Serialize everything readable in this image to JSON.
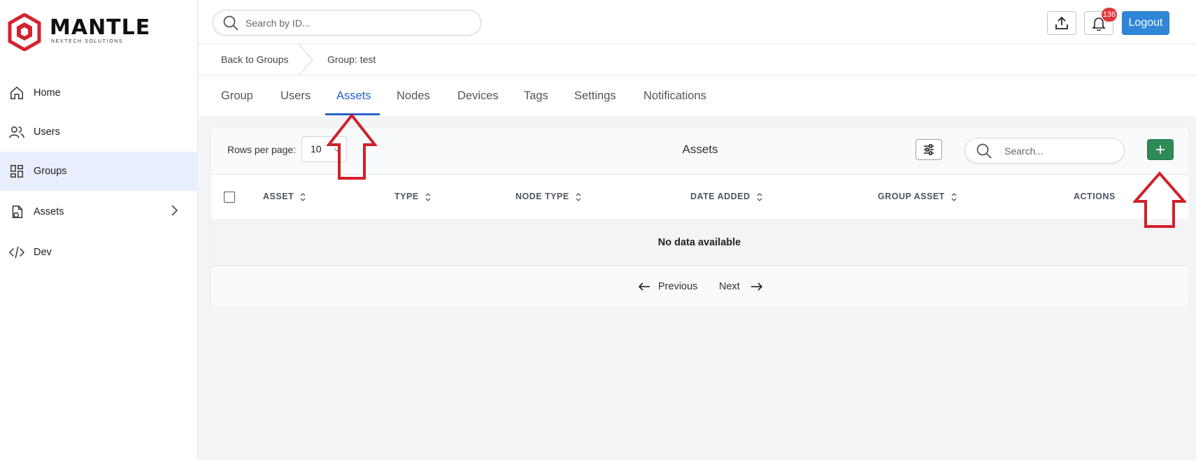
{
  "app": {
    "logo_text": "MANTLE",
    "logo_subtext": "NEXTECH SOLUTIONS"
  },
  "sidebar": {
    "items": [
      {
        "label": "Home",
        "icon": "home-icon"
      },
      {
        "label": "Users",
        "icon": "users-icon"
      },
      {
        "label": "Groups",
        "icon": "groups-icon",
        "active": true
      },
      {
        "label": "Assets",
        "icon": "assets-icon",
        "has_children": true
      },
      {
        "label": "Dev",
        "icon": "code-icon"
      }
    ]
  },
  "topbar": {
    "search_placeholder": "Search by ID...",
    "notification_count": "136",
    "logout_label": "Logout"
  },
  "breadcrumb": {
    "back_label": "Back to Groups",
    "current_label": "Group: test"
  },
  "tabs": [
    {
      "label": "Group"
    },
    {
      "label": "Users"
    },
    {
      "label": "Assets",
      "active": true
    },
    {
      "label": "Nodes"
    },
    {
      "label": "Devices"
    },
    {
      "label": "Tags"
    },
    {
      "label": "Settings"
    },
    {
      "label": "Notifications"
    }
  ],
  "assets_panel": {
    "rows_per_page_label": "Rows per page:",
    "rows_per_page_value": "10",
    "title": "Assets",
    "search_placeholder": "Search...",
    "columns": [
      "ASSET",
      "TYPE",
      "NODE TYPE",
      "DATE ADDED",
      "GROUP ASSET",
      "ACTIONS"
    ],
    "empty_message": "No data available",
    "pagination": {
      "previous_label": "Previous",
      "next_label": "Next"
    }
  },
  "colors": {
    "accent": "#2563c9",
    "logout": "#2f86d6",
    "add_button": "#2e8b57",
    "badge": "#e0363b",
    "annotation_arrow": "#d0202a",
    "logo_red": "#d4232f"
  }
}
